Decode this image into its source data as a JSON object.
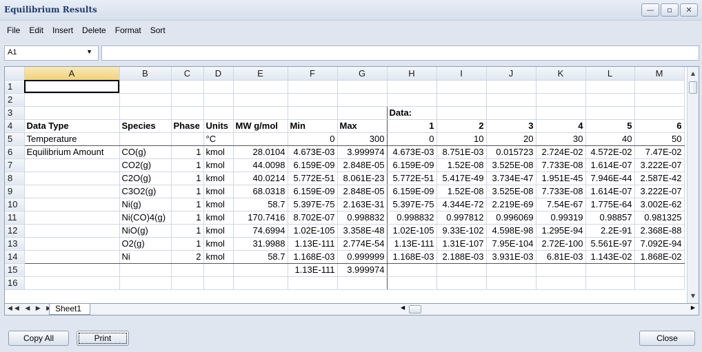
{
  "window": {
    "title": "Equilibrium Results",
    "controls": [
      "—",
      "▫",
      "✕"
    ]
  },
  "menu": [
    "File",
    "Edit",
    "Insert",
    "Delete",
    "Format",
    "Sort"
  ],
  "formula_bar": {
    "cell_ref": "A1",
    "value": ""
  },
  "columns": [
    "A",
    "B",
    "C",
    "D",
    "E",
    "F",
    "G",
    "H",
    "I",
    "J",
    "K",
    "L",
    "M"
  ],
  "rows": [
    [
      "",
      "",
      "",
      "",
      "",
      "",
      "",
      "",
      "",
      "",
      "",
      "",
      ""
    ],
    [
      "",
      "",
      "",
      "",
      "",
      "",
      "",
      "",
      "",
      "",
      "",
      "",
      ""
    ],
    [
      "",
      "",
      "",
      "",
      "",
      "",
      "",
      "Data:",
      "",
      "",
      "",
      "",
      ""
    ],
    [
      "Data Type",
      "Species",
      "Phase",
      "Units",
      "MW g/mol",
      "Min",
      "Max",
      "1",
      "2",
      "3",
      "4",
      "5",
      "6"
    ],
    [
      "Temperature",
      "",
      "",
      "°C",
      "",
      "0",
      "300",
      "0",
      "10",
      "20",
      "30",
      "40",
      "50"
    ],
    [
      "Equilibrium Amount",
      "CO(g)",
      "1",
      "kmol",
      "28.0104",
      "4.673E-03",
      "3.999974",
      "4.673E-03",
      "8.751E-03",
      "0.015723",
      "2.724E-02",
      "4.572E-02",
      "7.47E-02"
    ],
    [
      "",
      "CO2(g)",
      "1",
      "kmol",
      "44.0098",
      "6.159E-09",
      "2.848E-05",
      "6.159E-09",
      "1.52E-08",
      "3.525E-08",
      "7.733E-08",
      "1.614E-07",
      "3.222E-07"
    ],
    [
      "",
      "C2O(g)",
      "1",
      "kmol",
      "40.0214",
      "5.772E-51",
      "8.061E-23",
      "5.772E-51",
      "5.417E-49",
      "3.734E-47",
      "1.951E-45",
      "7.946E-44",
      "2.587E-42"
    ],
    [
      "",
      "C3O2(g)",
      "1",
      "kmol",
      "68.0318",
      "6.159E-09",
      "2.848E-05",
      "6.159E-09",
      "1.52E-08",
      "3.525E-08",
      "7.733E-08",
      "1.614E-07",
      "3.222E-07"
    ],
    [
      "",
      "Ni(g)",
      "1",
      "kmol",
      "58.7",
      "5.397E-75",
      "2.163E-31",
      "5.397E-75",
      "4.344E-72",
      "2.219E-69",
      "7.54E-67",
      "1.775E-64",
      "3.002E-62"
    ],
    [
      "",
      "Ni(CO)4(g)",
      "1",
      "kmol",
      "170.7416",
      "8.702E-07",
      "0.998832",
      "0.998832",
      "0.997812",
      "0.996069",
      "0.99319",
      "0.98857",
      "0.981325"
    ],
    [
      "",
      "NiO(g)",
      "1",
      "kmol",
      "74.6994",
      "1.02E-105",
      "3.358E-48",
      "1.02E-105",
      "9.33E-102",
      "4.598E-98",
      "1.295E-94",
      "2.2E-91",
      "2.368E-88"
    ],
    [
      "",
      "O2(g)",
      "1",
      "kmol",
      "31.9988",
      "1.13E-111",
      "2.774E-54",
      "1.13E-111",
      "1.31E-107",
      "7.95E-104",
      "2.72E-100",
      "5.561E-97",
      "7.092E-94"
    ],
    [
      "",
      "Ni",
      "2",
      "kmol",
      "58.7",
      "1.168E-03",
      "0.999999",
      "1.168E-03",
      "2.188E-03",
      "3.931E-03",
      "6.81E-03",
      "1.143E-02",
      "1.868E-02"
    ],
    [
      "",
      "",
      "",
      "",
      "",
      "1.13E-111",
      "3.999974",
      "",
      "",
      "",
      "",
      "",
      ""
    ],
    [
      "",
      "",
      "",
      "",
      "",
      "",
      "",
      "",
      "",
      "",
      "",
      "",
      ""
    ]
  ],
  "sheet_tabs": [
    "Sheet1"
  ],
  "buttons": {
    "copy_all": "Copy All",
    "print": "Print",
    "close": "Close"
  }
}
